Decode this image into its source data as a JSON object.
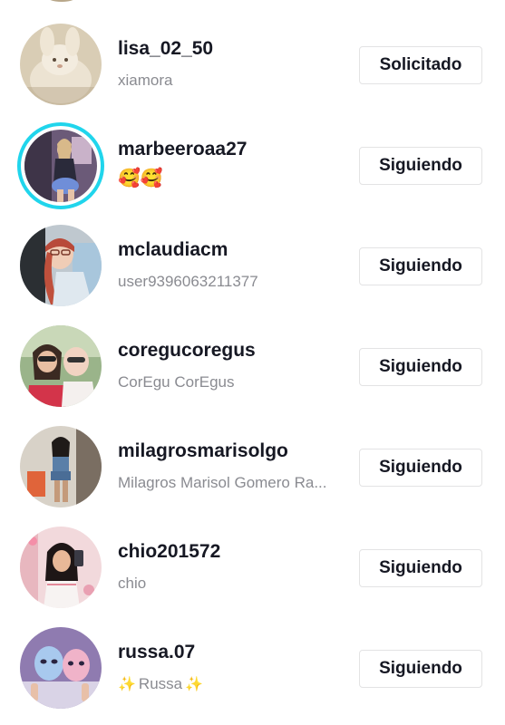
{
  "following_list": {
    "items": [
      {
        "username": "lisa_02_50",
        "subtitle": "xiamora",
        "button_label": "Solicitado",
        "has_story": false,
        "avatar_icon": "plush-bunny-photo"
      },
      {
        "username": "marbeeroaa27",
        "subtitle": "🥰🥰",
        "button_label": "Siguiendo",
        "has_story": true,
        "avatar_icon": "woman-in-room-photo"
      },
      {
        "username": "mclaudiacm",
        "subtitle": "user9396063211377",
        "button_label": "Siguiendo",
        "has_story": false,
        "avatar_icon": "woman-with-red-braid-photo"
      },
      {
        "username": "coregucoregus",
        "subtitle": "CorEgu CorEgus",
        "button_label": "Siguiendo",
        "has_story": false,
        "avatar_icon": "two-women-sunglasses-photo"
      },
      {
        "username": "milagrosmarisolgo",
        "subtitle": "Milagros Marisol Gomero Ra...",
        "button_label": "Siguiendo",
        "has_story": false,
        "avatar_icon": "woman-mirror-selfie-photo"
      },
      {
        "username": "chio201572",
        "subtitle": "chio",
        "button_label": "Siguiendo",
        "has_story": false,
        "avatar_icon": "woman-selfie-pink-photo"
      },
      {
        "username": "russa.07",
        "subtitle": "Russa",
        "subtitle_decoration": "✨",
        "button_label": "Siguiendo",
        "has_story": false,
        "avatar_icon": "masked-figures-photo"
      }
    ]
  },
  "colors": {
    "story_ring": "#20d5ec",
    "username_text": "#161823",
    "subtitle_text": "#8a8b91",
    "button_border": "#e3e3e4"
  }
}
